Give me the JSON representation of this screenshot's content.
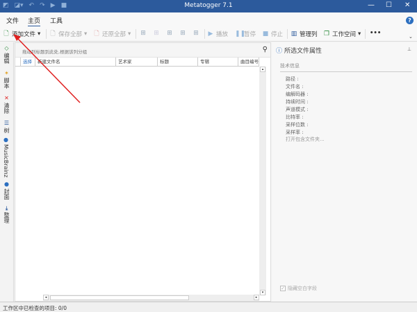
{
  "window": {
    "title": "Metatogger 7.1",
    "minimize": "—",
    "maximize": "☐",
    "close": "✕"
  },
  "menu": {
    "tabs": [
      {
        "label": "文件"
      },
      {
        "label": "主页",
        "selected": true
      },
      {
        "label": "工具"
      }
    ],
    "help": "?"
  },
  "toolbar": {
    "add_files": "添加文件",
    "save_all": "保存全部",
    "restore_all": "还原全部",
    "play": "播放",
    "pause": "暂停",
    "stop": "停止",
    "manage_columns": "管理列",
    "workspace": "工作空间",
    "more": "•••"
  },
  "sidebar": {
    "items": [
      {
        "label": "编辑",
        "icon": "tag-add-icon"
      },
      {
        "label": "脚本",
        "icon": "script-icon"
      },
      {
        "label": "清除",
        "icon": "tag-remove-icon"
      },
      {
        "label": "树",
        "icon": "tree-icon"
      },
      {
        "label": "MusicBrainz",
        "icon": "musicbrainz-icon"
      },
      {
        "label": "封面",
        "icon": "cover-icon"
      },
      {
        "label": "整理",
        "icon": "organize-icon"
      }
    ]
  },
  "grid": {
    "group_hint": "拖动列标题到此处,根据该列分组",
    "columns": [
      "选择",
      "新建文件名",
      "艺术家",
      "标题",
      "专辑",
      "曲目编号"
    ]
  },
  "panel": {
    "title": "所选文件属性",
    "section": "技术信息",
    "fields": [
      "路径 :",
      "文件名 :",
      "编解码器 :",
      "持续时间 :",
      "声道模式 :",
      "比特率 :",
      "采样位数 :",
      "采样率 :"
    ],
    "open_folder": "打开包含文件夹...",
    "hide_empty": "隐藏空白字段",
    "hide_empty_checked": true
  },
  "status": {
    "text": "工作区中已检查的项目:  0/0"
  },
  "colors": {
    "titlebar": "#2c5a9c",
    "annotation_arrow": "#e02020"
  }
}
